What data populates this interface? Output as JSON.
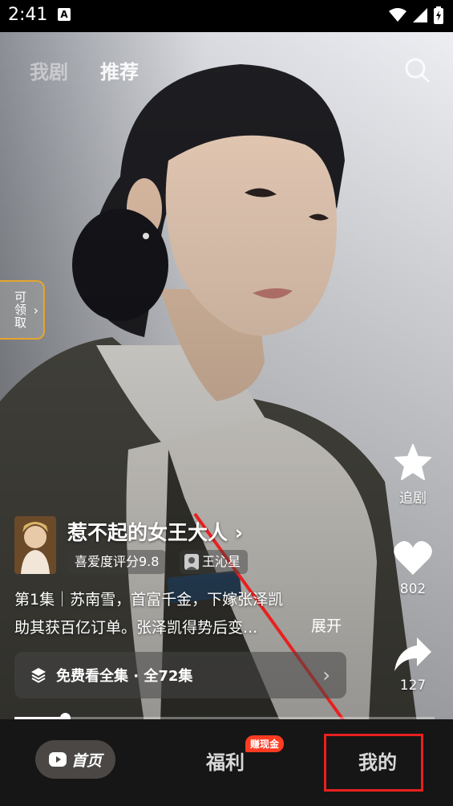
{
  "status_bar": {
    "time": "2:41",
    "a_icon_letter": "A"
  },
  "top_tabs": [
    {
      "label": "我剧",
      "active": false
    },
    {
      "label": "推荐",
      "active": true
    }
  ],
  "claim_badge": {
    "text": "可领取"
  },
  "actions": {
    "follow_label": "追剧",
    "like_count": "802",
    "share_count": "127"
  },
  "drama": {
    "title": "惹不起的女王大人",
    "rating": "喜爱度评分9.8",
    "actor": "王沁星",
    "description_line1": "第1集｜苏南雪，首富千金，下嫁张泽凯",
    "description_line2": "助其获百亿订单。张泽凯得势后变...",
    "expand_label": "展开",
    "watch_all": "免费看全集 · 全72集"
  },
  "progress": {
    "fraction": 0.12
  },
  "bottom_nav": {
    "home": "首页",
    "welfare": "福利",
    "welfare_badge": "赚现金",
    "mine": "我的"
  },
  "colors": {
    "accent_gold": "#e6a52d",
    "annotation_red": "#e8201f",
    "badge_red": "#ff3b22"
  }
}
